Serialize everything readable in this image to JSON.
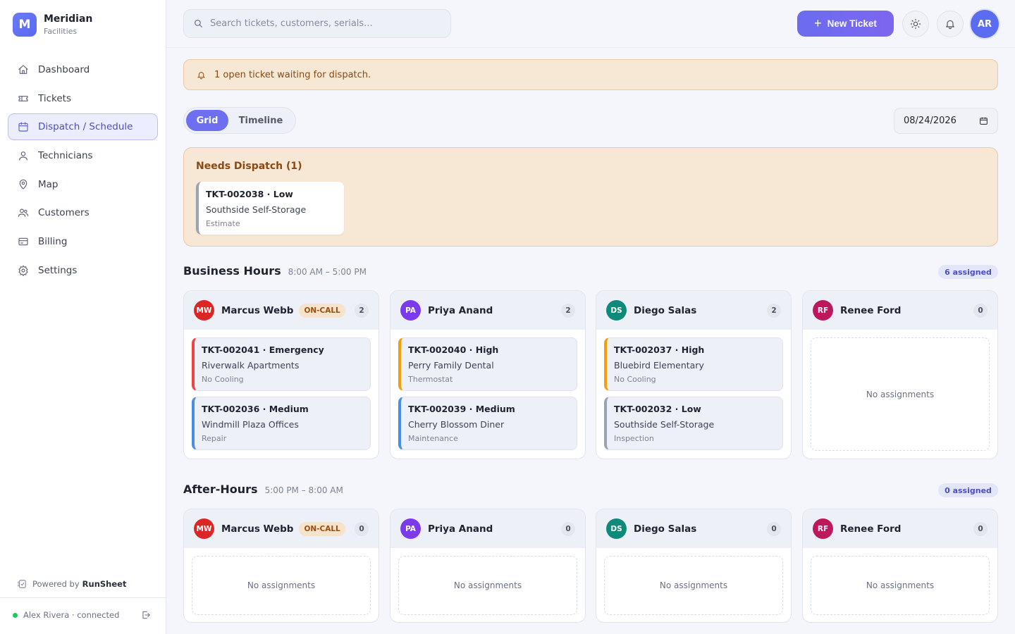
{
  "brand": {
    "initial": "M",
    "name": "Meridian",
    "subtitle": "Facilities"
  },
  "sidebar": {
    "items": [
      {
        "label": "Dashboard",
        "icon": "home-icon"
      },
      {
        "label": "Tickets",
        "icon": "ticket-icon"
      },
      {
        "label": "Dispatch / Schedule",
        "icon": "calendar-icon",
        "active": true
      },
      {
        "label": "Technicians",
        "icon": "user-icon"
      },
      {
        "label": "Map",
        "icon": "map-pin-icon"
      },
      {
        "label": "Customers",
        "icon": "users-icon"
      },
      {
        "label": "Billing",
        "icon": "credit-card-icon"
      },
      {
        "label": "Settings",
        "icon": "gear-icon"
      }
    ],
    "powered_prefix": "Powered by",
    "powered_brand": "RunSheet",
    "user_status": "Alex Rivera · connected"
  },
  "topbar": {
    "search_placeholder": "Search tickets, customers, serials...",
    "new_ticket_label": "New Ticket",
    "avatar_initials": "AR"
  },
  "alert": {
    "text": "1 open ticket waiting for dispatch."
  },
  "view_toggle": {
    "grid": "Grid",
    "timeline": "Timeline",
    "selected": "Grid"
  },
  "date": {
    "value": "08/24/2026"
  },
  "needs_dispatch": {
    "title": "Needs Dispatch (1)",
    "tickets": [
      {
        "title": "TKT-002038 · Low",
        "customer": "Southside Self-Storage",
        "type": "Estimate"
      }
    ]
  },
  "business_hours": {
    "title": "Business Hours",
    "hours": "8:00 AM – 5:00 PM",
    "assigned": "6 assigned",
    "columns": [
      {
        "initials": "MW",
        "name": "Marcus Webb",
        "oncall": "ON-CALL",
        "count": "2",
        "tickets": [
          {
            "title": "TKT-002041 · Emergency",
            "customer": "Riverwalk Apartments",
            "type": "No Cooling"
          },
          {
            "title": "TKT-002036 · Medium",
            "customer": "Windmill Plaza Offices",
            "type": "Repair"
          }
        ]
      },
      {
        "initials": "PA",
        "name": "Priya Anand",
        "count": "2",
        "tickets": [
          {
            "title": "TKT-002040 · High",
            "customer": "Perry Family Dental",
            "type": "Thermostat"
          },
          {
            "title": "TKT-002039 · Medium",
            "customer": "Cherry Blossom Diner",
            "type": "Maintenance"
          }
        ]
      },
      {
        "initials": "DS",
        "name": "Diego Salas",
        "count": "2",
        "tickets": [
          {
            "title": "TKT-002037 · High",
            "customer": "Bluebird Elementary",
            "type": "No Cooling"
          },
          {
            "title": "TKT-002032 · Low",
            "customer": "Southside Self-Storage",
            "type": "Inspection"
          }
        ]
      },
      {
        "initials": "RF",
        "name": "Renee Ford",
        "count": "0",
        "empty": "No assignments"
      }
    ]
  },
  "after_hours": {
    "title": "After-Hours",
    "hours": "5:00 PM – 8:00 AM",
    "assigned": "0 assigned",
    "columns": [
      {
        "initials": "MW",
        "name": "Marcus Webb",
        "oncall": "ON-CALL",
        "count": "0",
        "empty": "No assignments"
      },
      {
        "initials": "PA",
        "name": "Priya Anand",
        "count": "0",
        "empty": "No assignments"
      },
      {
        "initials": "DS",
        "name": "Diego Salas",
        "count": "0",
        "empty": "No assignments"
      },
      {
        "initials": "RF",
        "name": "Renee Ford",
        "count": "0",
        "empty": "No assignments"
      }
    ]
  },
  "colors": {
    "accent": "#6d6ff0",
    "avatar_mw": "#dc2626",
    "avatar_pa": "#7c3aed",
    "avatar_ds": "#0f8a7a",
    "avatar_rf": "#be185d",
    "priority_emergency": "#ef4444",
    "priority_high": "#f59e0b",
    "priority_medium": "#4a8fe7",
    "priority_low": "#9aa3b5"
  }
}
